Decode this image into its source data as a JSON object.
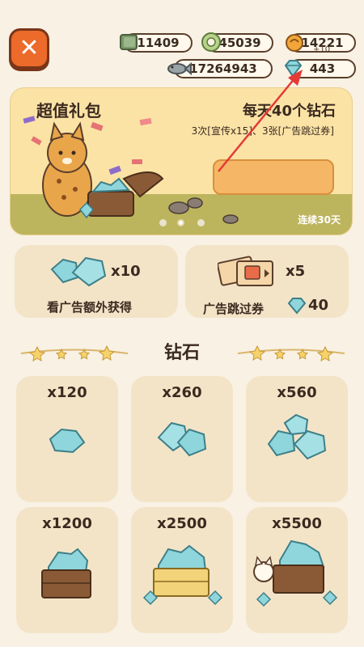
{
  "header": {
    "close_symbol": "✕",
    "resources": [
      {
        "icon": "cash-icon",
        "value": "11409"
      },
      {
        "icon": "coin-icon",
        "value": "45039"
      },
      {
        "icon": "bell-coin-icon",
        "value": "14221"
      },
      {
        "icon": "fish-icon",
        "value": "17264943"
      },
      {
        "icon": "diamond-icon",
        "value": "443"
      }
    ],
    "plus_note": "+10"
  },
  "banner": {
    "title": "超值礼包",
    "headline": "每天40个钻石",
    "subline": "3次[宣传x15]、3张[广告跳过券]",
    "days_label": "连续30天",
    "page_count": 3,
    "active_page": 2
  },
  "offers": {
    "ad_reward": {
      "qty": "x10",
      "label": "看广告额外获得"
    },
    "skip_ticket": {
      "qty": "x5",
      "label": "广告跳过券",
      "price": "40"
    }
  },
  "section_title": "钻石",
  "diamond_packs": [
    {
      "qty": "x120",
      "art": "small-gem-pile"
    },
    {
      "qty": "x260",
      "art": "medium-gem-pile"
    },
    {
      "qty": "x560",
      "art": "large-gem-pile"
    },
    {
      "qty": "x1200",
      "art": "wooden-crate-gems"
    },
    {
      "qty": "x2500",
      "art": "golden-crate-gems"
    },
    {
      "qty": "x5500",
      "art": "cat-crate-gems"
    }
  ],
  "colors": {
    "background": "#f8f1e4",
    "card": "#f3e4c8",
    "accent": "#ec6a2a",
    "gem": "#8fd6dc",
    "arrow": "#e53935"
  }
}
